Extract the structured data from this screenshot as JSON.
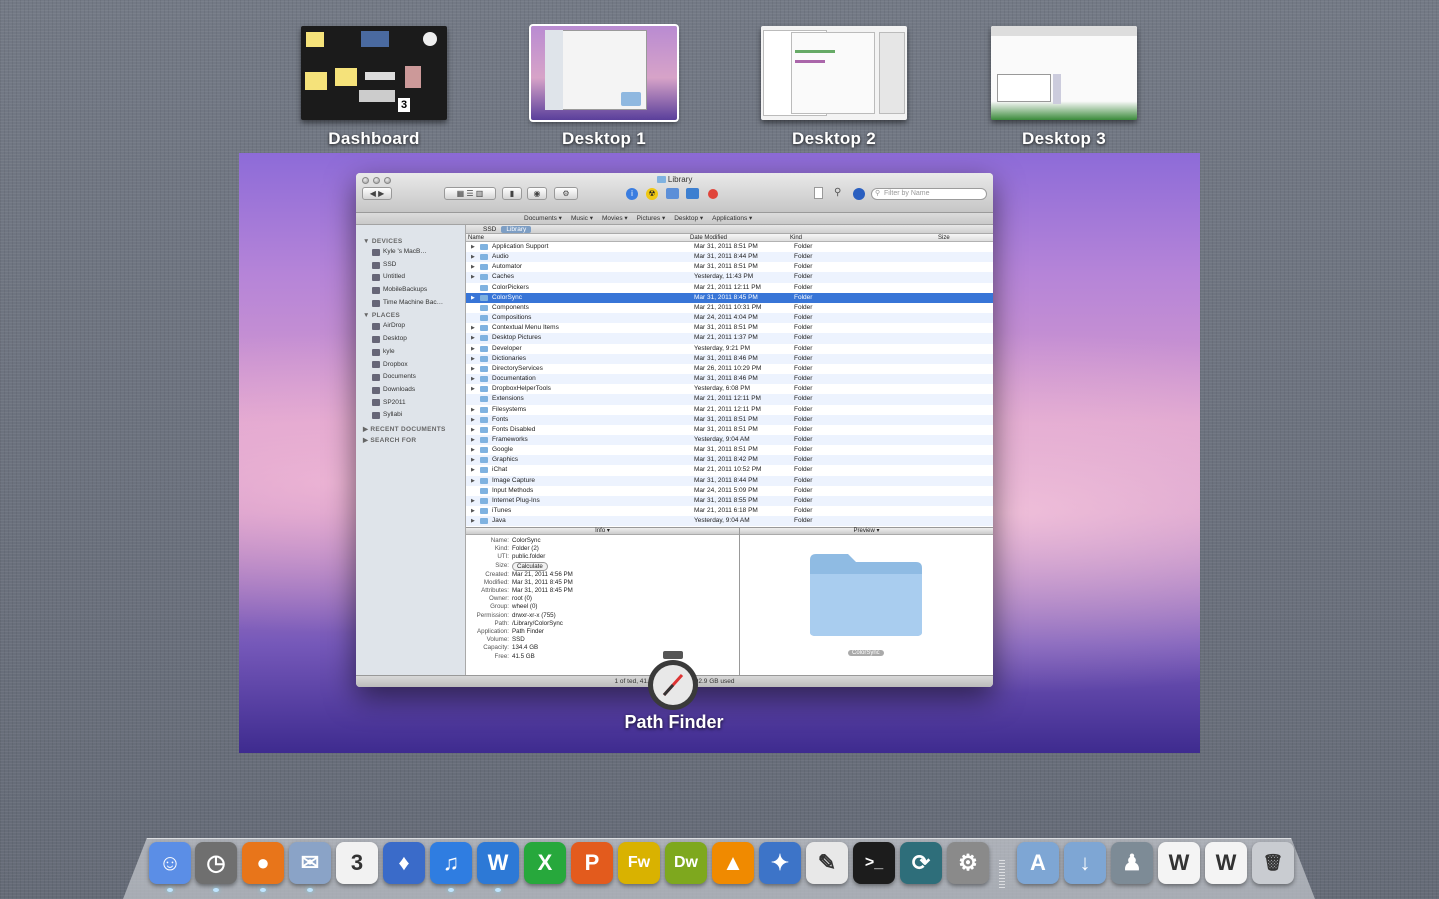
{
  "spaces": [
    {
      "label": "Dashboard",
      "active": false
    },
    {
      "label": "Desktop 1",
      "active": true
    },
    {
      "label": "Desktop 2",
      "active": false
    },
    {
      "label": "Desktop 3",
      "active": false
    }
  ],
  "window": {
    "title": "Library",
    "search_placeholder": "Filter by Name",
    "favorites": [
      "Documents ▾",
      "Music ▾",
      "Movies ▾",
      "Pictures ▾",
      "Desktop ▾",
      "Applications ▾"
    ],
    "path": [
      "SSD",
      "Library"
    ],
    "columns": {
      "name": "Name",
      "date": "Date Modified",
      "kind": "Kind",
      "size": "Size"
    },
    "sidebar": {
      "devices_header": "▼ DEVICES",
      "devices": [
        "Kyle         's MacB…",
        "SSD",
        "Untitled",
        "MobileBackups",
        "Time Machine Bac…"
      ],
      "places_header": "▼ PLACES",
      "places": [
        "AirDrop",
        "Desktop",
        "kyle",
        "Dropbox",
        "Documents",
        "Downloads",
        "SP2011",
        "Syllabi"
      ],
      "recent_header": "▶ RECENT DOCUMENTS",
      "search_header": "▶ SEARCH FOR"
    },
    "files": [
      {
        "name": "Application Support",
        "date": "Mar 31, 2011 8:51 PM",
        "kind": "Folder",
        "exp": true
      },
      {
        "name": "Audio",
        "date": "Mar 31, 2011 8:44 PM",
        "kind": "Folder",
        "exp": true
      },
      {
        "name": "Automator",
        "date": "Mar 31, 2011 8:51 PM",
        "kind": "Folder",
        "exp": true
      },
      {
        "name": "Caches",
        "date": "Yesterday, 11:43 PM",
        "kind": "Folder",
        "exp": true
      },
      {
        "name": "ColorPickers",
        "date": "Mar 21, 2011 12:11 PM",
        "kind": "Folder",
        "exp": false
      },
      {
        "name": "ColorSync",
        "date": "Mar 31, 2011 8:45 PM",
        "kind": "Folder",
        "exp": true,
        "sel": true
      },
      {
        "name": "Components",
        "date": "Mar 21, 2011 10:31 PM",
        "kind": "Folder",
        "exp": false
      },
      {
        "name": "Compositions",
        "date": "Mar 24, 2011 4:04 PM",
        "kind": "Folder",
        "exp": false
      },
      {
        "name": "Contextual Menu Items",
        "date": "Mar 31, 2011 8:51 PM",
        "kind": "Folder",
        "exp": true
      },
      {
        "name": "Desktop Pictures",
        "date": "Mar 21, 2011 1:37 PM",
        "kind": "Folder",
        "exp": true
      },
      {
        "name": "Developer",
        "date": "Yesterday, 9:21 PM",
        "kind": "Folder",
        "exp": true
      },
      {
        "name": "Dictionaries",
        "date": "Mar 31, 2011 8:46 PM",
        "kind": "Folder",
        "exp": true
      },
      {
        "name": "DirectoryServices",
        "date": "Mar 26, 2011 10:29 PM",
        "kind": "Folder",
        "exp": true
      },
      {
        "name": "Documentation",
        "date": "Mar 31, 2011 8:46 PM",
        "kind": "Folder",
        "exp": true
      },
      {
        "name": "DropboxHelperTools",
        "date": "Yesterday, 6:08 PM",
        "kind": "Folder",
        "exp": true
      },
      {
        "name": "Extensions",
        "date": "Mar 21, 2011 12:11 PM",
        "kind": "Folder",
        "exp": false
      },
      {
        "name": "Filesystems",
        "date": "Mar 21, 2011 12:11 PM",
        "kind": "Folder",
        "exp": true
      },
      {
        "name": "Fonts",
        "date": "Mar 31, 2011 8:51 PM",
        "kind": "Folder",
        "exp": true
      },
      {
        "name": "Fonts Disabled",
        "date": "Mar 31, 2011 8:51 PM",
        "kind": "Folder",
        "exp": true
      },
      {
        "name": "Frameworks",
        "date": "Yesterday, 9:04 AM",
        "kind": "Folder",
        "exp": true
      },
      {
        "name": "Google",
        "date": "Mar 31, 2011 8:51 PM",
        "kind": "Folder",
        "exp": true
      },
      {
        "name": "Graphics",
        "date": "Mar 31, 2011 8:42 PM",
        "kind": "Folder",
        "exp": true
      },
      {
        "name": "iChat",
        "date": "Mar 21, 2011 10:52 PM",
        "kind": "Folder",
        "exp": true
      },
      {
        "name": "Image Capture",
        "date": "Mar 31, 2011 8:44 PM",
        "kind": "Folder",
        "exp": true
      },
      {
        "name": "Input Methods",
        "date": "Mar 24, 2011 5:09 PM",
        "kind": "Folder",
        "exp": false
      },
      {
        "name": "Internet Plug-Ins",
        "date": "Mar 31, 2011 8:55 PM",
        "kind": "Folder",
        "exp": true
      },
      {
        "name": "iTunes",
        "date": "Mar 21, 2011 6:18 PM",
        "kind": "Folder",
        "exp": true
      },
      {
        "name": "Java",
        "date": "Yesterday, 9:04 AM",
        "kind": "Folder",
        "exp": true
      }
    ],
    "info_label": "Info ▾",
    "preview_label": "Preview ▾",
    "info": [
      {
        "k": "Name:",
        "v": "ColorSync"
      },
      {
        "k": "Kind:",
        "v": "Folder (2)"
      },
      {
        "k": "UTI:",
        "v": "public.folder"
      },
      {
        "k": "Size:",
        "v": "Calculate"
      },
      {
        "k": "Created:",
        "v": "Mar 21, 2011 4:56 PM"
      },
      {
        "k": "Modified:",
        "v": "Mar 31, 2011 8:45 PM"
      },
      {
        "k": "Attributes:",
        "v": "Mar 31, 2011 8:45 PM"
      },
      {
        "k": "Owner:",
        "v": "root (0)"
      },
      {
        "k": "Group:",
        "v": "wheel (0)"
      },
      {
        "k": "Permission:",
        "v": "drwxr-xr-x (755)"
      },
      {
        "k": "Path:",
        "v": "/Library/ColorSync"
      },
      {
        "k": "Application:",
        "v": "Path Finder"
      },
      {
        "k": "Volume:",
        "v": "SSD"
      },
      {
        "k": "Capacity:",
        "v": "134.4 GB"
      },
      {
        "k": "Free:",
        "v": "41.5 GB"
      }
    ],
    "preview_caption": "ColorSync",
    "status": "1 of            ted, 41.5 GB available, 92.9 GB used"
  },
  "app_label": "Path Finder",
  "dock": [
    {
      "name": "finder-icon",
      "color": "#5b8ee6",
      "glyph": "☺"
    },
    {
      "name": "path-finder-icon",
      "color": "#6f6f6f",
      "glyph": "◷"
    },
    {
      "name": "firefox-icon",
      "color": "#e8751a",
      "glyph": "●"
    },
    {
      "name": "mail-icon",
      "color": "#8aa3c7",
      "glyph": "✉"
    },
    {
      "name": "ical-icon",
      "color": "#f2f2f2",
      "glyph": "3"
    },
    {
      "name": "adium-icon",
      "color": "#3a6bc9",
      "glyph": "♦"
    },
    {
      "name": "itunes-icon",
      "color": "#2f7de1",
      "glyph": "♫"
    },
    {
      "name": "word-icon",
      "color": "#2d79d6",
      "glyph": "W"
    },
    {
      "name": "excel-icon",
      "color": "#27a83c",
      "glyph": "X"
    },
    {
      "name": "powerpoint-icon",
      "color": "#e35b1d",
      "glyph": "P"
    },
    {
      "name": "fireworks-icon",
      "color": "#d9b200",
      "glyph": "Fw"
    },
    {
      "name": "dreamweaver-icon",
      "color": "#7ea81e",
      "glyph": "Dw"
    },
    {
      "name": "vlc-icon",
      "color": "#f08a00",
      "glyph": "▲"
    },
    {
      "name": "xcode-icon",
      "color": "#3d74c8",
      "glyph": "✦"
    },
    {
      "name": "textedit-icon",
      "color": "#e8e8e8",
      "glyph": "✎"
    },
    {
      "name": "terminal-icon",
      "color": "#1c1c1c",
      "glyph": ">_"
    },
    {
      "name": "time-machine-icon",
      "color": "#2e6e7a",
      "glyph": "⟳"
    },
    {
      "name": "system-preferences-icon",
      "color": "#8a8a8a",
      "glyph": "⚙"
    },
    {
      "name": "applications-folder-icon",
      "color": "#7ea6d4",
      "glyph": "A"
    },
    {
      "name": "downloads-folder-icon",
      "color": "#7ea6d4",
      "glyph": "↓"
    },
    {
      "name": "penguins-icon",
      "color": "#7d8b96",
      "glyph": "♟"
    },
    {
      "name": "word-document-icon",
      "color": "#f4f4f4",
      "glyph": "W"
    },
    {
      "name": "word-document-2-icon",
      "color": "#f4f4f4",
      "glyph": "W"
    },
    {
      "name": "trash-icon",
      "color": "#c9ccd1",
      "glyph": "🗑"
    }
  ]
}
